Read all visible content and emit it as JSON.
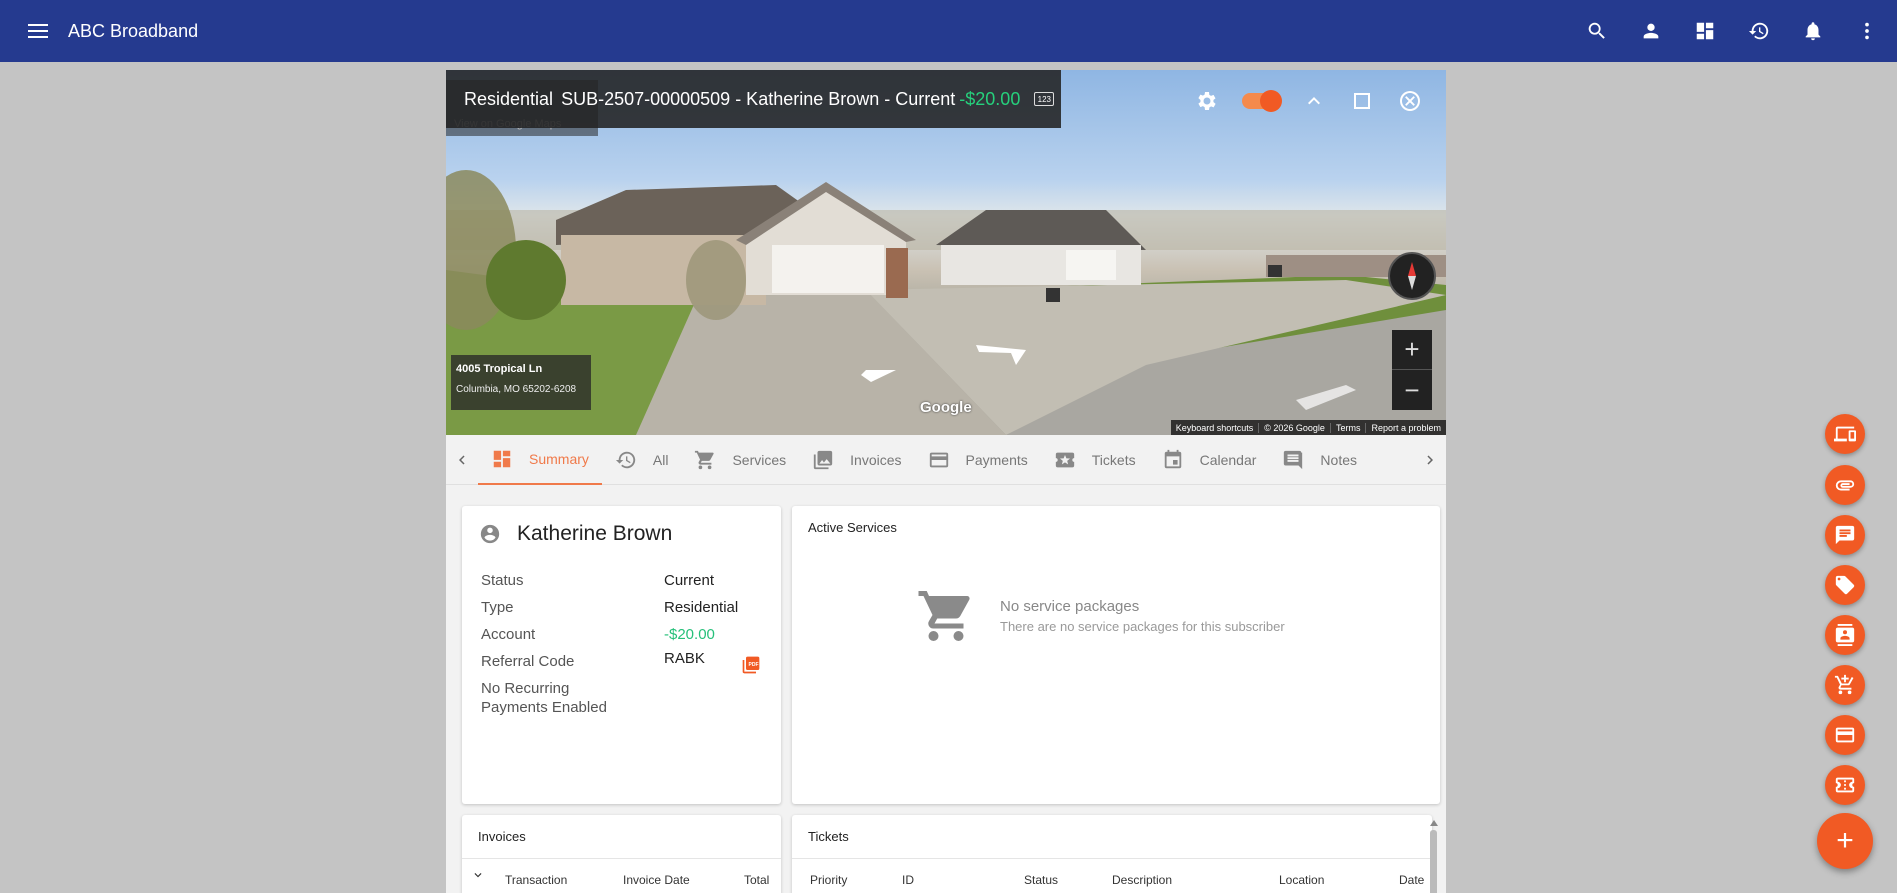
{
  "app": {
    "title": "ABC Broadband"
  },
  "header": {
    "icons": [
      "menu-icon",
      "search-icon",
      "account-icon",
      "dashboard-icon",
      "history-icon",
      "notifications-icon",
      "more-vert-icon"
    ]
  },
  "streetview": {
    "gmaps_link": "View on Google Maps",
    "address_line1": "4005 Tropical Ln",
    "address_line2": "Columbia, MO 65202-6208",
    "google": "Google",
    "attribution": [
      "Keyboard shortcuts",
      "© 2026 Google",
      "Terms",
      "Report a problem"
    ],
    "zoom_in": "+",
    "zoom_out": "−"
  },
  "subscriber_bar": {
    "type": "Residential",
    "id_name_status": "SUB-2507-00000509 - Katherine Brown - Current",
    "balance": "-$20.00",
    "badge": "123",
    "toggle_on": true
  },
  "tabs": [
    {
      "label": "Summary",
      "icon": "dashboard-icon",
      "active": true
    },
    {
      "label": "All",
      "icon": "history-icon"
    },
    {
      "label": "Services",
      "icon": "cart-icon"
    },
    {
      "label": "Invoices",
      "icon": "photos-icon"
    },
    {
      "label": "Payments",
      "icon": "credit-card-icon"
    },
    {
      "label": "Tickets",
      "icon": "ticket-star-icon"
    },
    {
      "label": "Calendar",
      "icon": "calendar-icon"
    },
    {
      "label": "Notes",
      "icon": "comment-icon"
    }
  ],
  "summary": {
    "name": "Katherine Brown",
    "rows": [
      {
        "label": "Status",
        "value": "Current"
      },
      {
        "label": "Type",
        "value": "Residential"
      },
      {
        "label": "Account",
        "value": "-$20.00"
      },
      {
        "label": "Referral Code",
        "value": "RABK"
      }
    ],
    "recurring_line1": "No Recurring",
    "recurring_line2": "Payments Enabled"
  },
  "active_services": {
    "title": "Active Services",
    "empty_title": "No service packages",
    "empty_sub": "There are no service packages for this subscriber"
  },
  "invoices_card": {
    "title": "Invoices",
    "columns": [
      "Transaction",
      "Invoice Date",
      "Total"
    ]
  },
  "tickets_card": {
    "title": "Tickets",
    "columns": [
      "Priority",
      "ID",
      "Status",
      "Description",
      "Location",
      "Date"
    ]
  },
  "fabs": [
    "devices-icon",
    "attachment-icon",
    "message-icon",
    "tag-icon",
    "contact-card-icon",
    "add-to-cart-icon",
    "credit-card-icon",
    "ticket-icon"
  ],
  "fab_main": "+",
  "colors": {
    "primary": "#253a8f",
    "accent": "#f15a24",
    "positive": "#26c07a"
  }
}
